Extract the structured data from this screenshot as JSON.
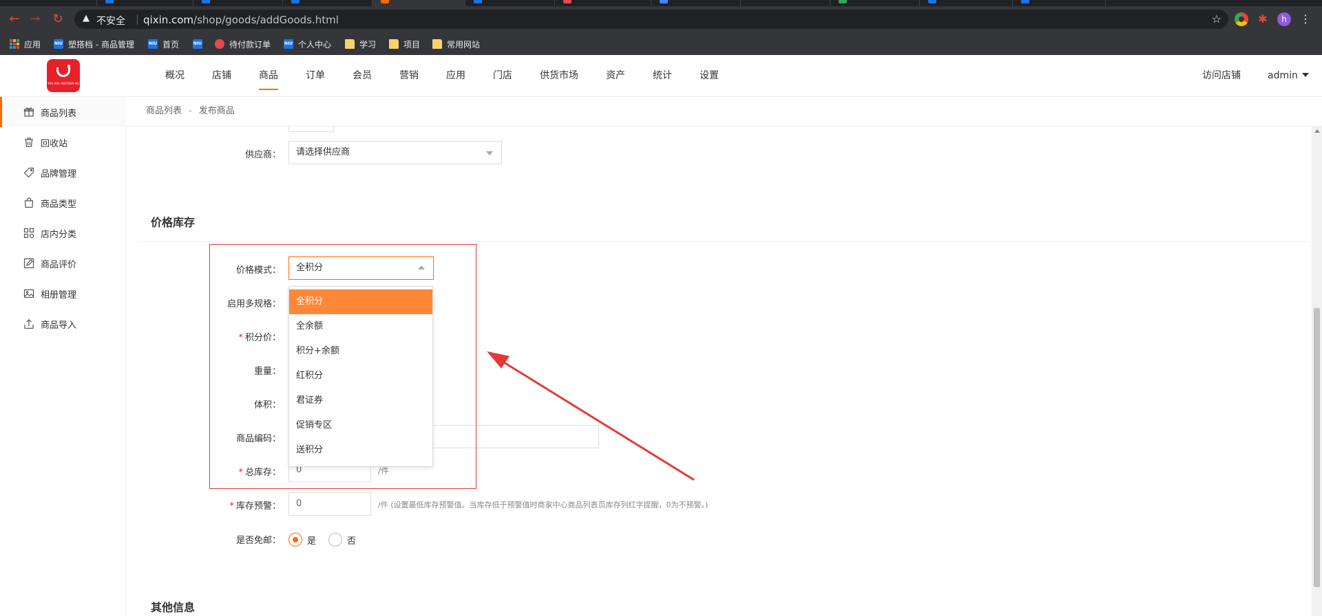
{
  "browser": {
    "insecure_label": "不安全",
    "url_host": "qixin.com",
    "url_path": "/shop/goods/addGoods.html",
    "profile_initial": "h",
    "bookmarks": [
      "应用",
      "塑搭档 - 商品管理",
      "首页",
      "",
      "待付款订单",
      "个人中心",
      "学习",
      "项目",
      "常用网站"
    ],
    "niu_icon": "NIU"
  },
  "header": {
    "logo_tagline": "YOU ARE ANOTHER ME",
    "nav": [
      "概况",
      "店铺",
      "商品",
      "订单",
      "会员",
      "营销",
      "应用",
      "门店",
      "供货市场",
      "资产",
      "统计",
      "设置"
    ],
    "active_nav": "商品",
    "visit_store": "访问店铺",
    "user": "admin"
  },
  "sidebar": {
    "items": [
      {
        "label": "商品列表",
        "icon": "gift-icon"
      },
      {
        "label": "回收站",
        "icon": "trash-icon"
      },
      {
        "label": "品牌管理",
        "icon": "tag-icon"
      },
      {
        "label": "商品类型",
        "icon": "bag-icon"
      },
      {
        "label": "店内分类",
        "icon": "grid-icon"
      },
      {
        "label": "商品评价",
        "icon": "edit-icon"
      },
      {
        "label": "相册管理",
        "icon": "image-icon"
      },
      {
        "label": "商品导入",
        "icon": "upload-icon"
      }
    ],
    "active": "商品列表"
  },
  "breadcrumb": {
    "parent": "商品列表",
    "separator": "-",
    "current": "发布商品"
  },
  "form": {
    "supplier": {
      "label": "供应商：",
      "placeholder": "请选择供应商"
    },
    "section_price": "价格库存",
    "price_mode": {
      "label": "价格模式：",
      "value": "全积分"
    },
    "multi_spec": {
      "label": "启用多规格："
    },
    "points_price": {
      "label": "积分价："
    },
    "weight": {
      "label": "重量："
    },
    "volume": {
      "label": "体积："
    },
    "goods_code": {
      "label": "商品编码："
    },
    "total_stock": {
      "label": "总库存：",
      "value": "0",
      "unit": "/件"
    },
    "stock_warning": {
      "label": "库存预警：",
      "value": "0",
      "unit": "/件 (设置最低库存预警值。当库存低于预警值时商家中心商品列表页库存列红字提醒，0为不预警。)"
    },
    "free_shipping": {
      "label": "是否免邮：",
      "yes": "是",
      "no": "否",
      "selected": "是"
    },
    "section_other": "其他信息",
    "price_mode_options": [
      "全积分",
      "全余额",
      "积分+余额",
      "红积分",
      "君证券",
      "促销专区",
      "送积分"
    ]
  },
  "colors": {
    "accent": "#ff6a00",
    "option_selected": "#ff8738",
    "annotation": "#e53935",
    "logo": "#e8202a"
  }
}
